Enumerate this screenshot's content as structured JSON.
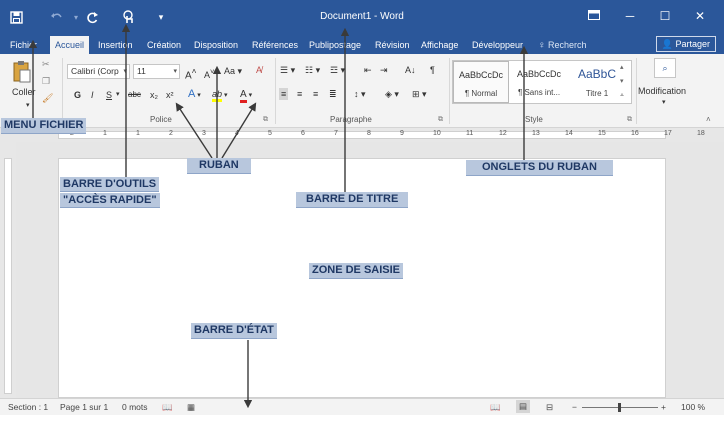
{
  "titlebar": {
    "title": "Document1 - Word",
    "quick_access": {
      "save_icon": "save-icon",
      "undo_icon": "undo-icon",
      "redo_icon": "redo-icon",
      "touch_mode_icon": "touch-mode-icon",
      "customize_icon": "customize-dropdown-icon"
    },
    "window_controls": [
      "ribbon-display-icon",
      "minimize-icon",
      "maximize-icon",
      "close-icon"
    ]
  },
  "tabs": {
    "file": "Fichier",
    "home": "Accueil",
    "insert": "Insertion",
    "design": "Création",
    "layout": "Disposition",
    "references": "Références",
    "mailings": "Publipostage",
    "review": "Révision",
    "view": "Affichage",
    "developer": "Développeur",
    "search": "Recherch",
    "share": "Partager"
  },
  "ribbon": {
    "clipboard": {
      "paste": "Coller"
    },
    "font": {
      "label": "Police",
      "font_name": "Calibri (Corp",
      "font_size": "11",
      "grow": "A",
      "shrink": "A",
      "case": "Aa",
      "bold": "G",
      "italic": "I",
      "underline": "S",
      "strike": "abc",
      "subscript": "x₂",
      "superscript": "x²",
      "effects": "A",
      "highlight": "ab",
      "font_color": "A"
    },
    "paragraph": {
      "label": "Paragraphe",
      "pilcrow": "¶"
    },
    "style": {
      "label": "Style",
      "items": [
        {
          "preview": "AaBbCcDc",
          "name": "¶ Normal"
        },
        {
          "preview": "AaBbCcDc",
          "name": "¶ Sans int..."
        },
        {
          "preview": "AaBbC",
          "name": "Titre 1"
        }
      ]
    },
    "editing": {
      "label": "Modification"
    }
  },
  "ruler_marks": [
    "2",
    "1",
    "1",
    "2",
    "3",
    "4",
    "5",
    "6",
    "7",
    "8",
    "9",
    "10",
    "11",
    "12",
    "13",
    "14",
    "15",
    "16",
    "17",
    "18"
  ],
  "statusbar": {
    "section": "Section : 1",
    "page": "Page 1 sur 1",
    "words": "0 mots",
    "zoom_out": "−",
    "zoom_in": "+",
    "zoom": "100 %"
  },
  "annotations": {
    "menu_file": "MENU FICHIER",
    "quick_access_line1": "BARRE D'OUTILS",
    "quick_access_line2": "\"ACCÈS RAPIDE\"",
    "ribbon": "RUBAN",
    "title_bar": "BARRE DE TITRE",
    "ribbon_tabs": "ONGLETS DU RUBAN",
    "input_zone": "ZONE DE SAISIE",
    "status_bar": "BARRE D'ÉTAT"
  },
  "colors": {
    "accent": "#2b579a",
    "annotation_bg": "#b8c7dd",
    "annotation_text": "#1f3864",
    "arrow": "#3a3a3a"
  }
}
